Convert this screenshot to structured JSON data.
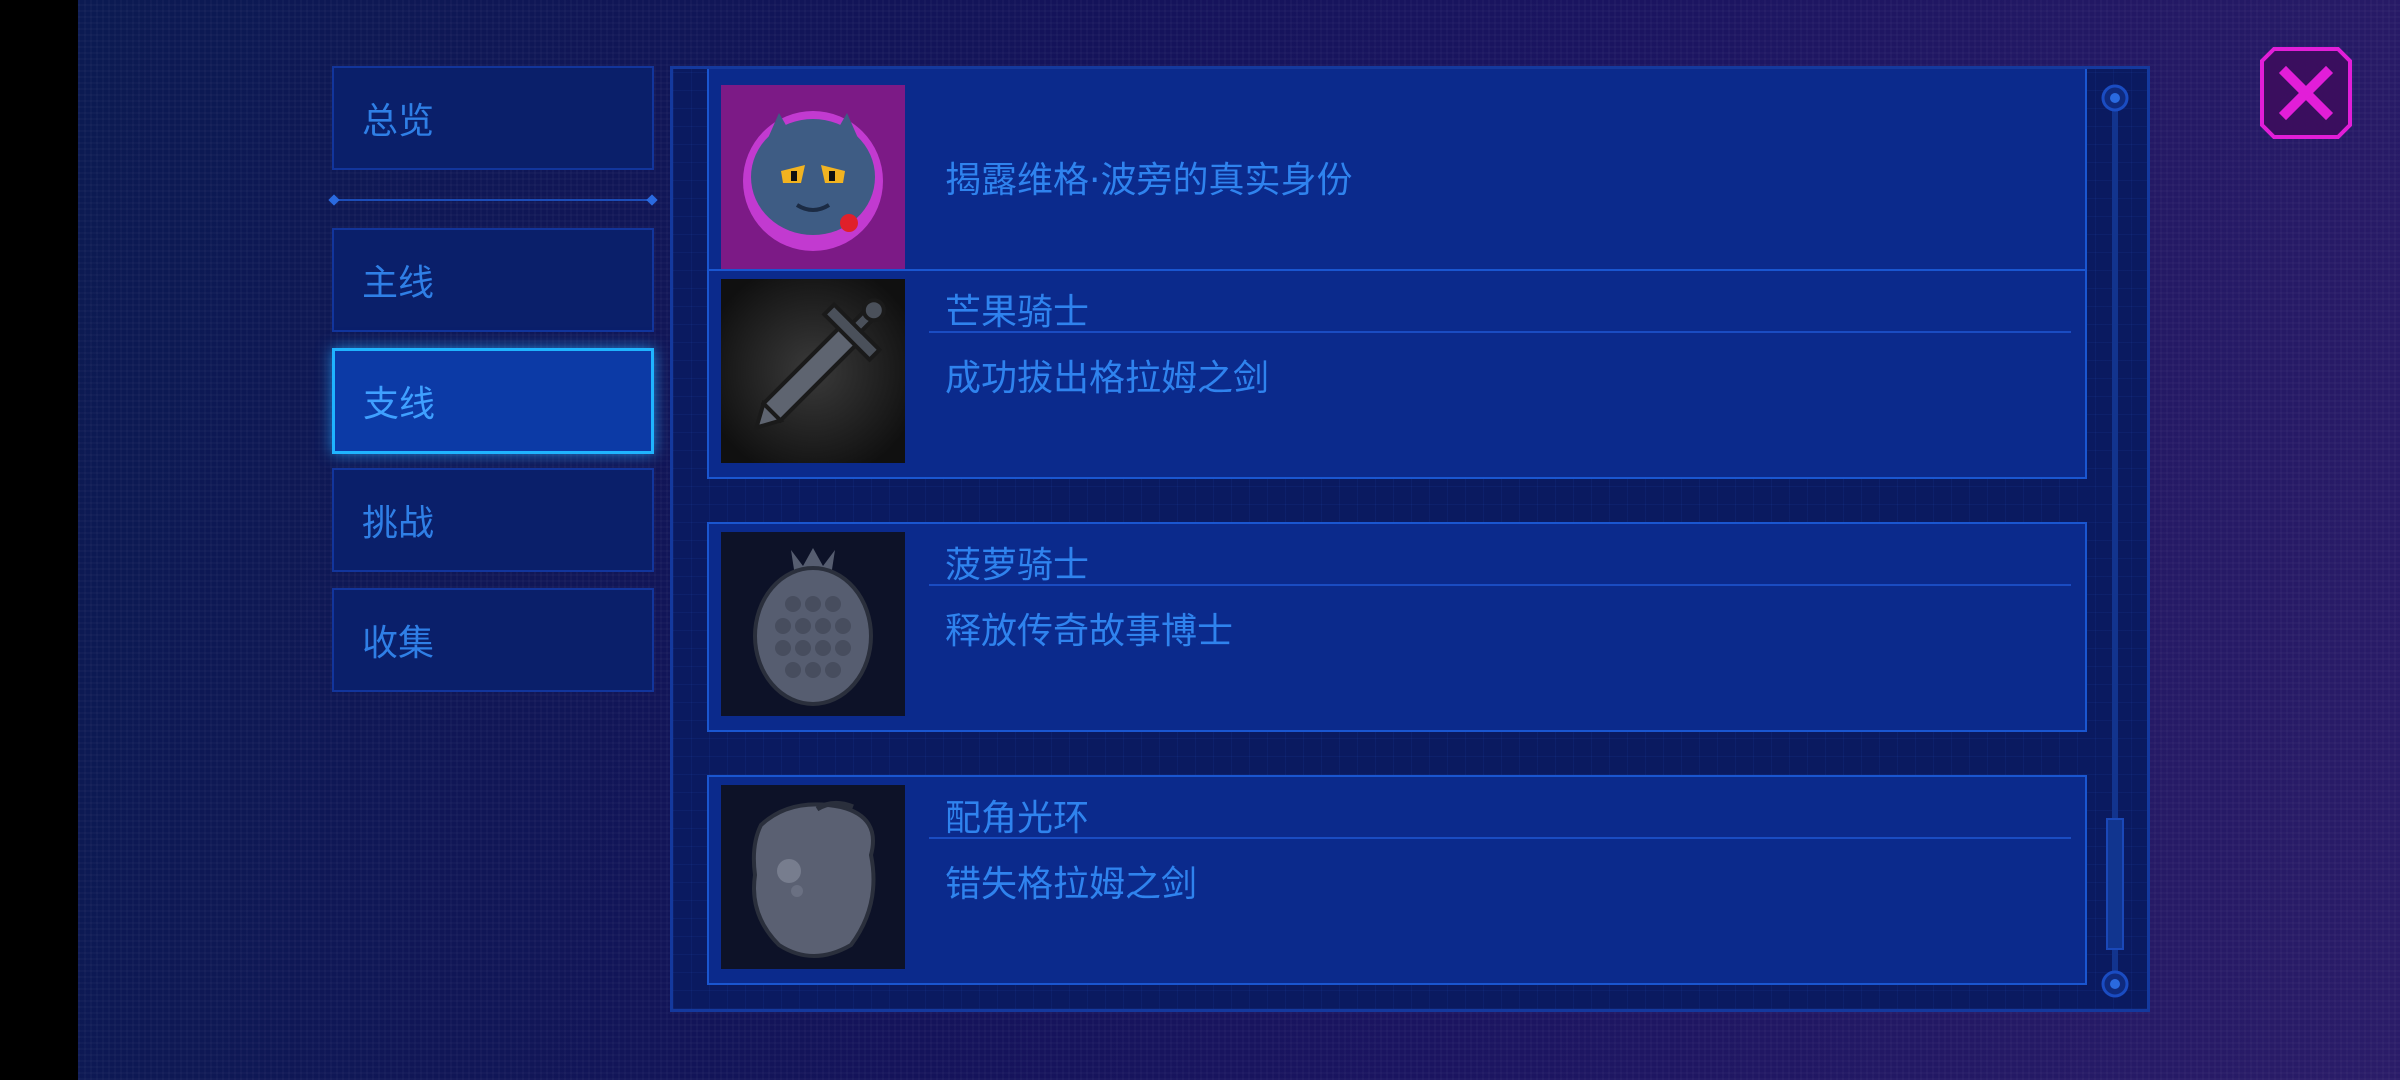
{
  "tabs": [
    {
      "label": "总览",
      "active": false
    },
    {
      "label": "主线",
      "active": false
    },
    {
      "label": "支线",
      "active": true
    },
    {
      "label": "挑战",
      "active": false
    },
    {
      "label": "收集",
      "active": false
    }
  ],
  "achievements": [
    {
      "title": "",
      "description": "揭露维格·波旁的真实身份",
      "icon": "cat-villain-icon"
    },
    {
      "title": "芒果骑士",
      "description": "成功拔出格拉姆之剑",
      "icon": "sword-icon"
    },
    {
      "title": "菠萝骑士",
      "description": "释放传奇故事博士",
      "icon": "pineapple-icon"
    },
    {
      "title": "配角光环",
      "description": "错失格拉姆之剑",
      "icon": "mango-icon"
    }
  ],
  "colors": {
    "accent": "#2f83ee",
    "active_border": "#1fb4ff",
    "close": "#e21ed8"
  }
}
